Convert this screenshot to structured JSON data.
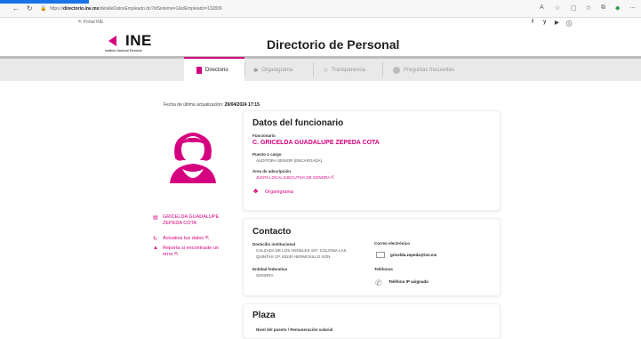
{
  "browser": {
    "url_prefix": "https://",
    "url_host": "directorio.ine.mx",
    "url_rest": "/detalleDatosEmpleado.do?idSistema=1&idEmpleado=132836"
  },
  "topbar": {
    "portal_label": "Portal INE",
    "social": [
      "f",
      "y",
      "▶",
      "ⓘ"
    ]
  },
  "header": {
    "logo_text": "INE",
    "logo_sub": "Instituto Nacional Electoral",
    "title": "Directorio de Personal"
  },
  "nav": {
    "items": [
      {
        "label": "Directorio"
      },
      {
        "label": "Organigrama"
      },
      {
        "label": "Transparencia"
      },
      {
        "label": "Preguntas frecuentes"
      }
    ]
  },
  "update": {
    "label": "Fecha de última actualización:",
    "value": "29/04/2024 17:15"
  },
  "sidebar": {
    "name": "GRICELDA GUADALUPE ZEPEDA COTA",
    "update_link": "Actualiza tus datos",
    "report_link": "Reporta si encontraste un error"
  },
  "funcionario": {
    "title": "Datos del funcionario",
    "name_label": "Funcionario",
    "name": "C. GRICELDA GUADALUPE ZEPEDA COTA",
    "position_label": "Puesto o cargo",
    "position": "AUDITORA SENIOR (ENCARGADA)",
    "area_label": "Área de adscripción",
    "area": "JUNTA LOCAL EJECUTIVA DE SONORA",
    "org_link": "Organigrama"
  },
  "contacto": {
    "title": "Contacto",
    "address_label": "Domicilio institucional",
    "address_line1": "CALZADA DE LOS ANGELES 197, COLONIA LAS",
    "address_line2": "QUINTAS CP. 83240 HERMOSILLO SON.",
    "state_label": "Entidad federativa",
    "state": "SONORA",
    "email_label": "Correo electrónico",
    "email": "gricelda.zepeda@ine.mx",
    "phone_label": "Teléfonos",
    "phone": "Teléfono IP asignado"
  },
  "plaza": {
    "title": "Plaza",
    "level_label": "Nivel del puesto / Remuneración salarial"
  },
  "colors": {
    "accent": "#d5007f",
    "nav_bg": "#e9e9e9"
  }
}
